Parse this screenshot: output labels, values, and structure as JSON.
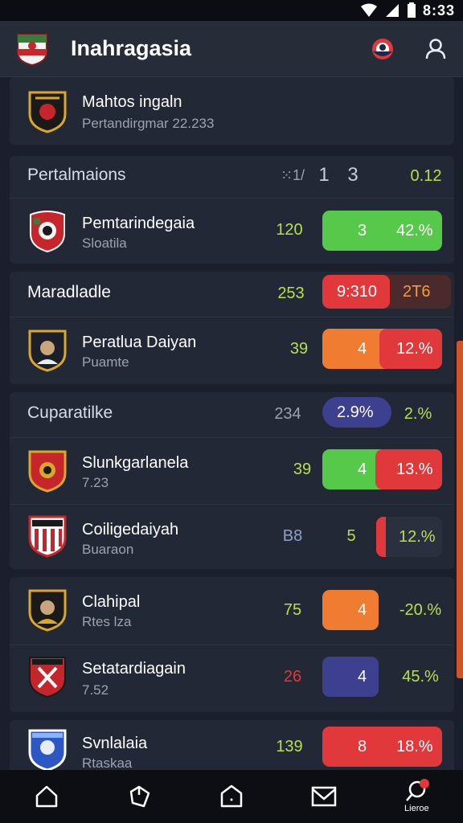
{
  "status": {
    "time": "8:33"
  },
  "header": {
    "title": "Inahragasia"
  },
  "featured": {
    "name": "Mahtos ingaln",
    "sub": "Pertandirgmar 22.233"
  },
  "sections": [
    {
      "label": "Pertalmaions",
      "c1": "⁙1/",
      "c2": "1",
      "c3": "3",
      "c4": "0.12"
    },
    {
      "label": "Maradladle",
      "value": "253",
      "pill_left": "9:310",
      "pill_right": "2T6"
    },
    {
      "label": "Cuparatilke",
      "value": "234",
      "pill_left": "2.9%",
      "pill_right": "2.%"
    }
  ],
  "teams": [
    {
      "name": "Pemtarindegaia",
      "sub": "Sloatila",
      "value": "120",
      "pill_num": "3",
      "pill_pct": "42.%"
    },
    {
      "name": "Peratlua Daiyan",
      "sub": "Puamte",
      "value": "39",
      "pill_num": "4",
      "pill_pct": "12.%"
    },
    {
      "name": "Slunkgarlanela",
      "sub": "7.23",
      "value": "39",
      "pill_num": "4",
      "pill_pct": "13.%"
    },
    {
      "name": "Coiligedaiyah",
      "sub": "Buaraon",
      "value": "B8",
      "pill_num": "5",
      "pill_pct": "12.%"
    },
    {
      "name": "Clahipal",
      "sub": "Rtes lza",
      "value": "75",
      "pill_num": "4",
      "pill_pct": "-20.%"
    },
    {
      "name": "Setatardiagain",
      "sub": "7.52",
      "value": "26",
      "pill_num": "4",
      "pill_pct": "45.%"
    },
    {
      "name": "Svnlalaia",
      "sub": "Rtaskaa",
      "value": "139",
      "pill_num": "8",
      "pill_pct": "18.%"
    }
  ],
  "nav": {
    "last_label": "Lieroe"
  },
  "colors": {
    "green": "#57c94a",
    "red": "#e0383b",
    "orange": "#ef7c30",
    "indigo": "#3d3f8f",
    "value_green": "#b5e04a",
    "value_red": "#e0383b",
    "value_blue": "#8da1c8"
  }
}
